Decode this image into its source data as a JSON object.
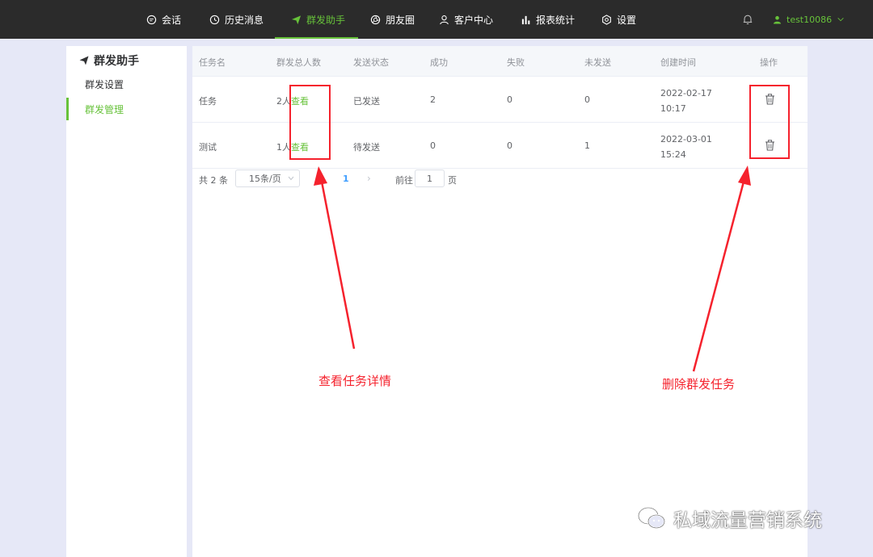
{
  "nav": {
    "items": [
      {
        "label": "会话",
        "icon": "chat-icon"
      },
      {
        "label": "历史消息",
        "icon": "clock-icon"
      },
      {
        "label": "群发助手",
        "icon": "send-icon",
        "active": true
      },
      {
        "label": "朋友圈",
        "icon": "aperture-icon"
      },
      {
        "label": "客户中心",
        "icon": "person-icon"
      },
      {
        "label": "报表统计",
        "icon": "bar-chart-icon"
      },
      {
        "label": "设置",
        "icon": "gear-icon"
      }
    ],
    "notification_icon": "bell-icon",
    "user": "test10086"
  },
  "sidebar": {
    "title": "群发助手",
    "items": [
      {
        "label": "群发设置",
        "active": false
      },
      {
        "label": "群发管理",
        "active": true
      }
    ]
  },
  "table": {
    "columns": [
      "任务名",
      "群发总人数",
      "发送状态",
      "成功",
      "失败",
      "未发送",
      "创建时间",
      "操作"
    ],
    "rows": [
      {
        "name": "任务",
        "total": "2人",
        "view": "查看",
        "status": "已发送",
        "success": "2",
        "fail": "0",
        "unsent": "0",
        "created": "2022-02-17 10:17"
      },
      {
        "name": "测试",
        "total": "1人",
        "view": "查看",
        "status": "待发送",
        "success": "0",
        "fail": "0",
        "unsent": "1",
        "created": "2022-03-01 15:24"
      }
    ]
  },
  "pagination": {
    "total": "共 2 条",
    "page_size": "15条/页",
    "current_page": "1",
    "goto_label": "前往",
    "goto_value": "1",
    "page_suffix": "页"
  },
  "annotations": {
    "view_note": "查看任务详情",
    "delete_note": "删除群发任务"
  },
  "watermark": {
    "text": "私域流量营销系统"
  },
  "colors": {
    "accent": "#67c23a",
    "annotation": "#f5222d",
    "topbar": "#2b2b2b",
    "background": "#e6e8f7"
  }
}
